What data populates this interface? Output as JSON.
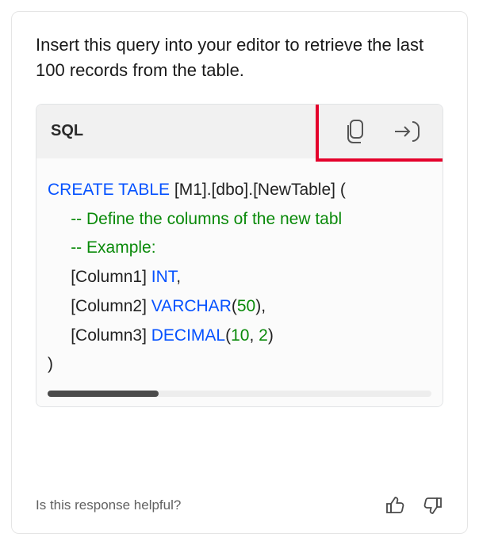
{
  "intro_text": "Insert this query into your editor to retrieve the last 100 records from the table.",
  "code_block": {
    "language_label": "SQL",
    "lines": [
      {
        "segments": [
          {
            "text": "CREATE TABLE",
            "cls": "kw"
          },
          {
            "text": " [M1].[dbo].[NewTable] (",
            "cls": ""
          }
        ],
        "indent": 0
      },
      {
        "segments": [
          {
            "text": "-- Define the columns of the new tabl",
            "cls": "cm"
          }
        ],
        "indent": 1
      },
      {
        "segments": [
          {
            "text": "-- Example:",
            "cls": "cm"
          }
        ],
        "indent": 1
      },
      {
        "segments": [
          {
            "text": "[Column1] ",
            "cls": ""
          },
          {
            "text": "INT",
            "cls": "ty"
          },
          {
            "text": ",",
            "cls": ""
          }
        ],
        "indent": 1
      },
      {
        "segments": [
          {
            "text": "[Column2] ",
            "cls": ""
          },
          {
            "text": "VARCHAR",
            "cls": "ty"
          },
          {
            "text": "(",
            "cls": ""
          },
          {
            "text": "50",
            "cls": "num"
          },
          {
            "text": "),",
            "cls": ""
          }
        ],
        "indent": 1
      },
      {
        "segments": [
          {
            "text": "[Column3] ",
            "cls": ""
          },
          {
            "text": "DECIMAL",
            "cls": "ty"
          },
          {
            "text": "(",
            "cls": ""
          },
          {
            "text": "10",
            "cls": "num"
          },
          {
            "text": ", ",
            "cls": ""
          },
          {
            "text": "2",
            "cls": "num"
          },
          {
            "text": ")",
            "cls": ""
          }
        ],
        "indent": 1
      },
      {
        "segments": [
          {
            "text": ")",
            "cls": ""
          }
        ],
        "indent": 0
      }
    ]
  },
  "feedback_prompt": "Is this response helpful?",
  "icons": {
    "copy": "copy-icon",
    "insert": "insert-into-editor-icon",
    "thumbs_up": "thumbs-up-icon",
    "thumbs_down": "thumbs-down-icon"
  }
}
